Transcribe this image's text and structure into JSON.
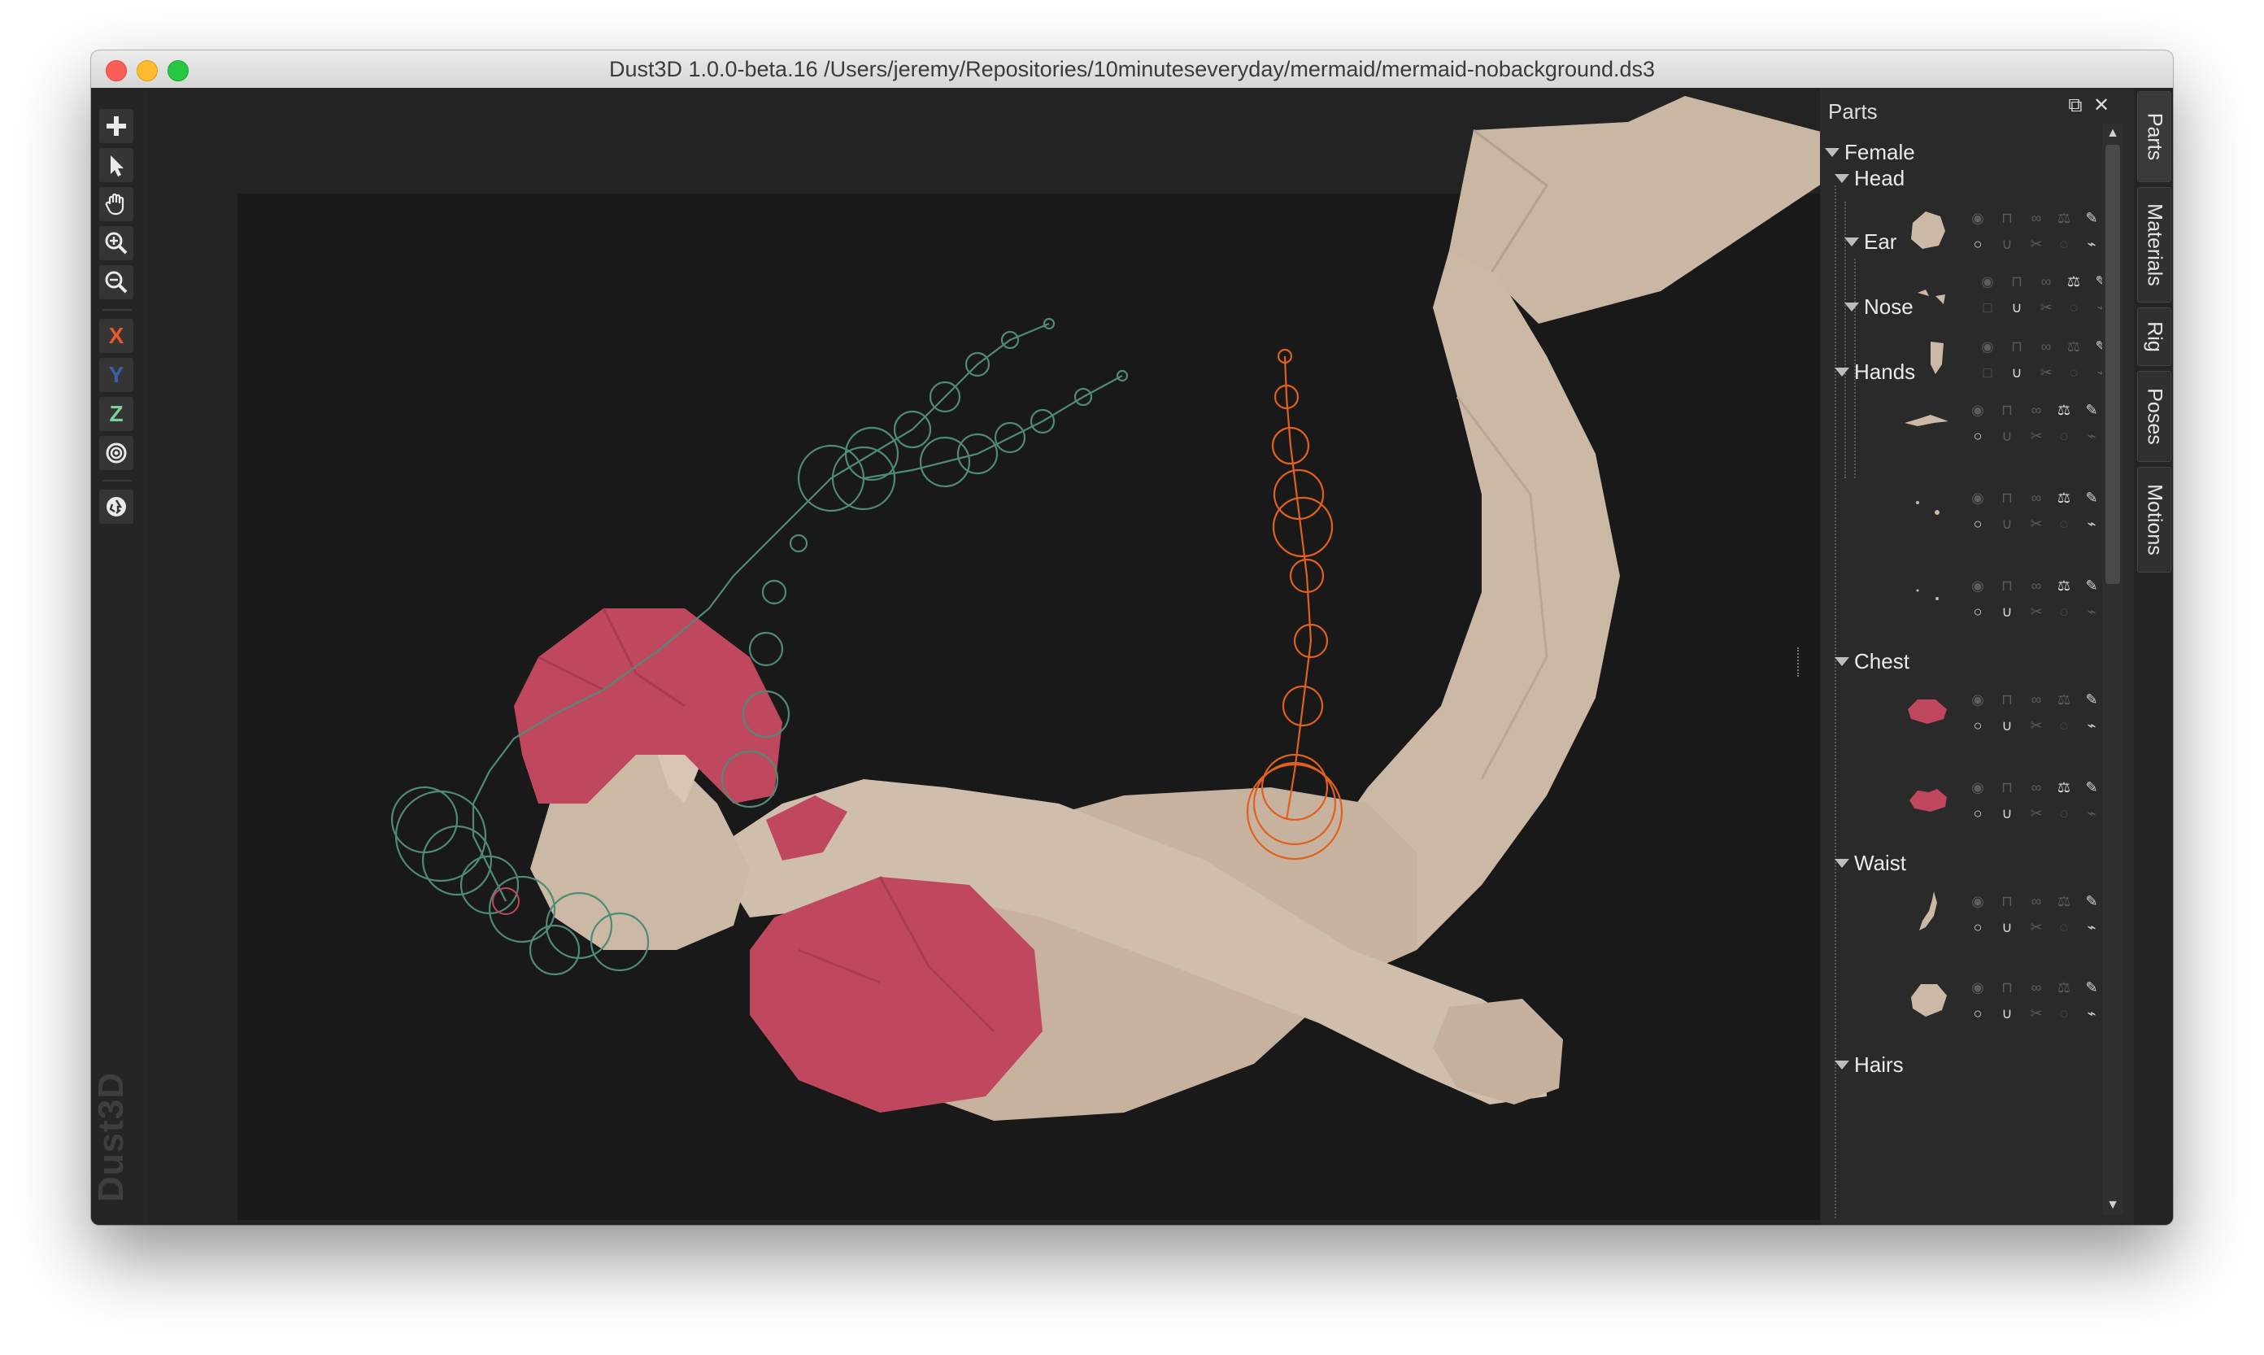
{
  "window": {
    "title": "Dust3D 1.0.0-beta.16 /Users/jeremy/Repositories/10minuteseveryday/mermaid/mermaid-nobackground.ds3"
  },
  "toolbar": {
    "tools": [
      {
        "name": "add",
        "icon": "plus-icon"
      },
      {
        "name": "select",
        "icon": "pointer-icon"
      },
      {
        "name": "pan",
        "icon": "hand-icon"
      },
      {
        "name": "zoom-in",
        "icon": "zoom-in-icon"
      },
      {
        "name": "zoom-out",
        "icon": "zoom-out-icon"
      },
      {
        "name": "x-lock",
        "label": "X",
        "color": "#e8592a"
      },
      {
        "name": "y-lock",
        "label": "Y",
        "color": "#3b5fa8"
      },
      {
        "name": "z-lock",
        "label": "Z",
        "color": "#7fcf9a"
      },
      {
        "name": "radius-lock",
        "icon": "target-icon"
      },
      {
        "name": "recycle",
        "icon": "recycle-icon"
      }
    ],
    "brand": "Dust3D"
  },
  "viewport": {
    "model_colors": {
      "skin": "#cbb8a5",
      "top": "#c0485e",
      "bone_green": "#4f8a78",
      "bone_orange": "#e0601d"
    }
  },
  "parts_panel": {
    "title": "Parts",
    "float_icon": "float-icon",
    "close_icon": "close-icon",
    "groups": {
      "female": "Female",
      "head": "Head",
      "ear": "Ear",
      "nose": "Nose",
      "hands": "Hands",
      "chest": "Chest",
      "waist": "Waist",
      "hairs": "Hairs"
    }
  },
  "side_tabs": [
    "Parts",
    "Materials",
    "Rig",
    "Poses",
    "Motions"
  ]
}
